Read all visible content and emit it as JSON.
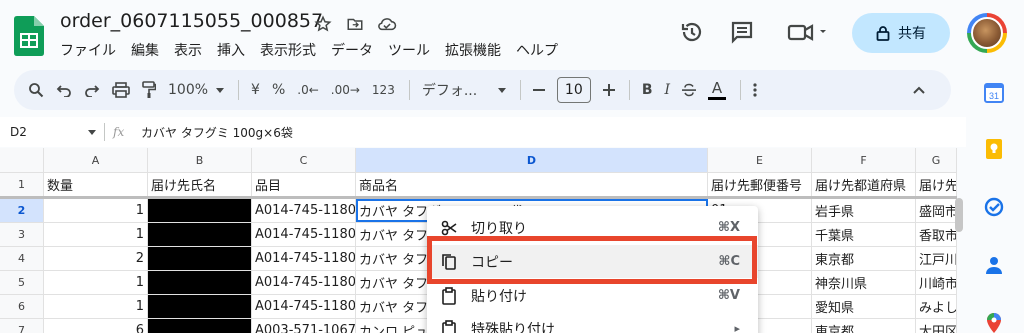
{
  "title": "order_0607115055_000857",
  "menu": [
    "ファイル",
    "編集",
    "表示",
    "挿入",
    "表示形式",
    "データ",
    "ツール",
    "拡張機能",
    "ヘルプ"
  ],
  "share_label": "共有",
  "toolbar": {
    "zoom": "100%",
    "currency": "¥",
    "percent": "%",
    "dec_less": ".0←",
    "dec_more": ".00→",
    "format_123": "123",
    "font": "デフォ...",
    "font_size": "10",
    "bold": "B",
    "italic": "I",
    "underline_a": "A"
  },
  "formula_bar": {
    "cell_ref": "D2",
    "fx": "fx",
    "value": "カバヤ タフグミ 100g×6袋"
  },
  "columns": [
    "A",
    "B",
    "C",
    "D",
    "E",
    "F",
    "G"
  ],
  "rows": [
    {
      "num": "1",
      "a": "数量",
      "b": "届け先氏名",
      "c": "品目",
      "d": "商品名",
      "e": "届け先郵便番号",
      "f": "届け先都道府県",
      "g": "届け先"
    },
    {
      "num": "2",
      "a": "1",
      "b": "",
      "c": "A014-745-1180",
      "d": "カバヤ タフグミ 100g×6袋",
      "e": "01",
      "f": "岩手県",
      "g": "盛岡市"
    },
    {
      "num": "3",
      "a": "1",
      "b": "",
      "c": "A014-745-1180",
      "d": "カバヤ タフ",
      "e": "7",
      "f": "千葉県",
      "g": "香取市"
    },
    {
      "num": "4",
      "a": "2",
      "b": "",
      "c": "A014-745-1180",
      "d": "カバヤ タフ",
      "e": "3",
      "f": "東京都",
      "g": "江戸川"
    },
    {
      "num": "5",
      "a": "1",
      "b": "",
      "c": "A014-745-1180",
      "d": "カバヤ タフ",
      "e": "5",
      "f": "神奈川県",
      "g": "川崎市"
    },
    {
      "num": "6",
      "a": "1",
      "b": "",
      "c": "A014-745-1180",
      "d": "カバヤ タフ",
      "e": "6",
      "f": "愛知県",
      "g": "みよし"
    },
    {
      "num": "7",
      "a": "6",
      "b": "",
      "c": "A003-571-1067",
      "d": "カンロ ピュ",
      "e": "5",
      "f": "東京都",
      "g": "大田区"
    }
  ],
  "context_menu": [
    {
      "label": "切り取り",
      "shortcut": "⌘X"
    },
    {
      "label": "コピー",
      "shortcut": "⌘C"
    },
    {
      "label": "貼り付け",
      "shortcut": "⌘V"
    },
    {
      "label": "特殊貼り付け",
      "shortcut": "▸"
    }
  ],
  "side_calendar_day": "31"
}
